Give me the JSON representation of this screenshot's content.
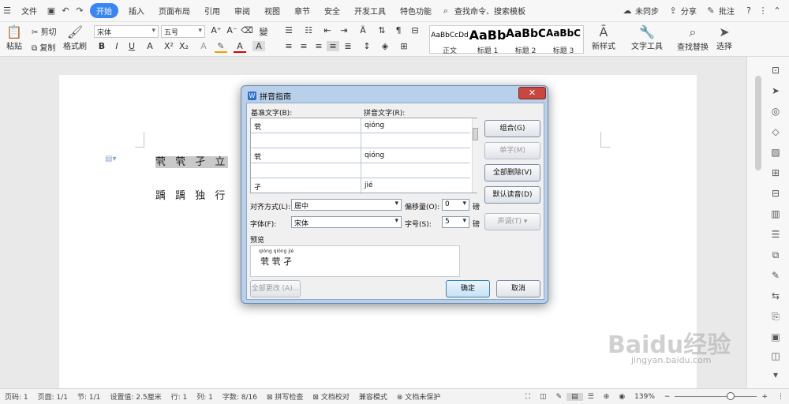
{
  "menubar": {
    "file": "文件",
    "tabs": [
      "开始",
      "插入",
      "页面布局",
      "引用",
      "审阅",
      "视图",
      "章节",
      "安全",
      "开发工具",
      "特色功能"
    ],
    "search": "查找命令、搜索模板",
    "sync": "未同步",
    "share": "分享",
    "comment": "批注"
  },
  "ribbon": {
    "paste": "粘贴",
    "cut": "剪切",
    "copy": "复制",
    "format_painter": "格式刷",
    "font_name": "宋体",
    "font_size": "五号",
    "styles": [
      {
        "preview": "AaBbCcDd",
        "name": "正文"
      },
      {
        "preview": "AaBb",
        "name": "标题 1"
      },
      {
        "preview": "AaBbC",
        "name": "标题 2"
      },
      {
        "preview": "AaBbC",
        "name": "标题 3"
      }
    ],
    "new_style": "新样式",
    "text_tools": "文字工具",
    "find_replace": "查找替换",
    "select": "选择"
  },
  "document": {
    "line1": "茕 茕 孑 立",
    "line2": "踽 踽 独 行"
  },
  "dialog": {
    "title": "拼音指南",
    "base_label": "基准文字(B):",
    "ruby_label": "拼音文字(R):",
    "rows": [
      {
        "base": "茕",
        "ruby": "qióng"
      },
      {
        "base": "",
        "ruby": ""
      },
      {
        "base": "茕",
        "ruby": "qióng"
      },
      {
        "base": "",
        "ruby": ""
      },
      {
        "base": "孑",
        "ruby": "jié"
      }
    ],
    "btn_group": "组合(G)",
    "btn_single": "单字(M)",
    "btn_clear_all": "全部删除(V)",
    "btn_default": "默认读音(D)",
    "btn_tone": "声调(T)",
    "align_label": "对齐方式(L):",
    "align_value": "居中",
    "offset_label": "偏移量(O):",
    "offset_value": "0",
    "offset_unit": "磅",
    "font_label": "字体(F):",
    "font_value": "宋体",
    "size_label": "字号(S):",
    "size_value": "5",
    "size_unit": "磅",
    "preview_label": "预览",
    "preview_ruby": "qióng qióng jié",
    "preview_text": "茕 茕 孑",
    "btn_apply_all": "全部更改 (A)...",
    "btn_ok": "确定",
    "btn_cancel": "取消"
  },
  "statusbar": {
    "page_num": "页码: 1",
    "pages": "页面: 1/1",
    "section": "节: 1/1",
    "setting": "设置值: 2.5厘米",
    "row": "行: 1",
    "col": "列: 1",
    "words": "字数: 8/16",
    "spell": "拼写检查",
    "proof": "文档校对",
    "compat": "兼容模式",
    "protect": "文档未保护",
    "zoom": "139%"
  },
  "watermark": {
    "line1": "Baidu经验",
    "line2": "jingyan.baidu.com"
  }
}
